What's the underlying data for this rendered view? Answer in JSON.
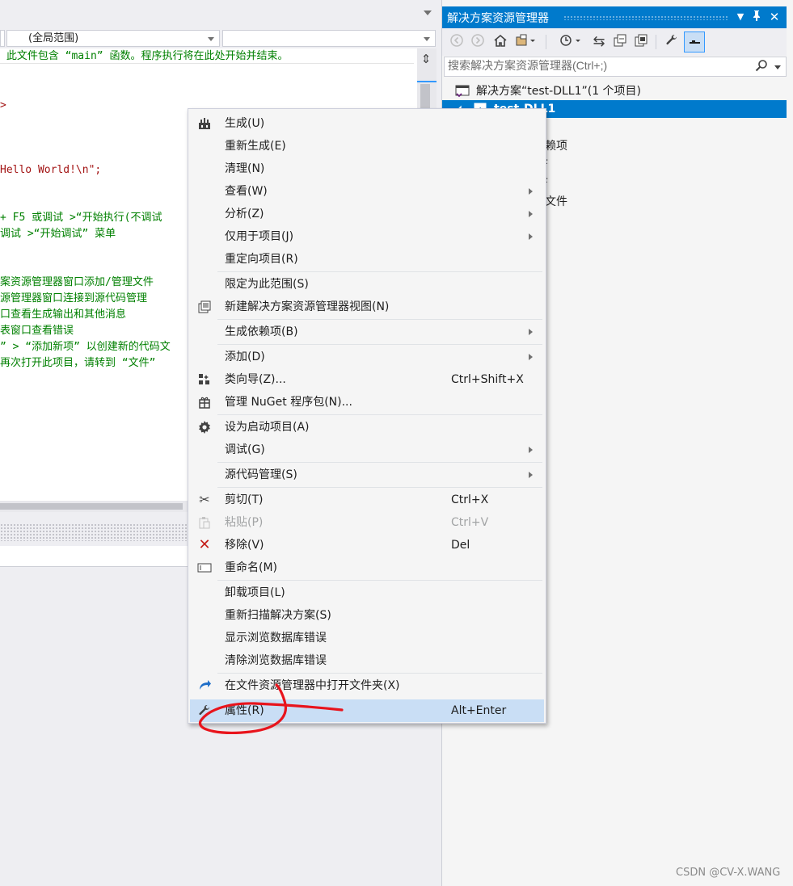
{
  "editor": {
    "scope_combo": "(全局范围)",
    "member_combo": "",
    "code_lines": [
      {
        "text": " 此文件包含 “main” 函数。程序执行将在此处开始并结束。",
        "kind": "comment"
      },
      {
        "text": ">",
        "kind": "string"
      },
      {
        "text": "Hello World!\\n\";",
        "kind": "string"
      },
      {
        "text": "+ F5 或调试 >“开始执行(不调试",
        "kind": "comment"
      },
      {
        "text": "调试 >“开始调试” 菜单",
        "kind": "comment"
      },
      {
        "text": "案资源管理器窗口添加/管理文件",
        "kind": "comment"
      },
      {
        "text": "源管理器窗口连接到源代码管理",
        "kind": "comment"
      },
      {
        "text": "口查看生成输出和其他消息",
        "kind": "comment"
      },
      {
        "text": "表窗口查看错误",
        "kind": "comment"
      },
      {
        "text": "” > “添加新项” 以创建新的代码文",
        "kind": "comment"
      },
      {
        "text": "再次打开此项目，请转到 “文件”",
        "kind": "comment"
      }
    ]
  },
  "solution_explorer": {
    "title": "解决方案资源管理器",
    "search_placeholder": "搜索解决方案资源管理器(Ctrl+;)",
    "solution_node": "解决方案“test-DLL1”(1 个项目)",
    "project_node": "test-DLL1",
    "partial_items": [
      "依赖项",
      "F",
      "F",
      "文件"
    ],
    "toolbar_icons": [
      "back-icon",
      "forward-icon",
      "home-icon",
      "switch-views-icon",
      "pending-changes-icon",
      "sync-icon",
      "collapse-all-icon",
      "show-all-files-icon",
      "properties-icon",
      "preview-icon"
    ]
  },
  "context_menu": {
    "items": [
      {
        "label": "生成(U)",
        "icon": "build-icon"
      },
      {
        "label": "重新生成(E)"
      },
      {
        "label": "清理(N)"
      },
      {
        "label": "查看(W)",
        "submenu": true
      },
      {
        "label": "分析(Z)",
        "submenu": true
      },
      {
        "label": "仅用于项目(J)",
        "submenu": true
      },
      {
        "label": "重定向项目(R)"
      },
      {
        "label": "限定为此范围(S)"
      },
      {
        "label": "新建解决方案资源管理器视图(N)",
        "icon": "new-view-icon"
      },
      {
        "label": "生成依赖项(B)",
        "submenu": true
      },
      {
        "label": "添加(D)",
        "submenu": true
      },
      {
        "label": "类向导(Z)...",
        "shortcut": "Ctrl+Shift+X",
        "icon": "class-wizard-icon"
      },
      {
        "label": "管理 NuGet 程序包(N)...",
        "icon": "nuget-icon"
      },
      {
        "label": "设为启动项目(A)",
        "icon": "gear-icon"
      },
      {
        "label": "调试(G)",
        "submenu": true
      },
      {
        "label": "源代码管理(S)",
        "submenu": true
      },
      {
        "label": "剪切(T)",
        "shortcut": "Ctrl+X",
        "icon": "cut-icon"
      },
      {
        "label": "粘贴(P)",
        "shortcut": "Ctrl+V",
        "icon": "paste-icon",
        "disabled": true
      },
      {
        "label": "移除(V)",
        "shortcut": "Del",
        "icon": "remove-icon"
      },
      {
        "label": "重命名(M)",
        "icon": "rename-icon"
      },
      {
        "label": "卸载项目(L)"
      },
      {
        "label": "重新扫描解决方案(S)"
      },
      {
        "label": "显示浏览数据库错误"
      },
      {
        "label": "清除浏览数据库错误"
      },
      {
        "label": "在文件资源管理器中打开文件夹(X)",
        "icon": "open-folder-icon"
      },
      {
        "label": "属性(R)",
        "shortcut": "Alt+Enter",
        "icon": "wrench-icon",
        "highlighted": true
      }
    ]
  },
  "colors": {
    "accent": "#007acc",
    "highlight": "#c9def5",
    "annotation": "#e8141c",
    "comment": "#008000",
    "string": "#a31515"
  },
  "watermark": "CSDN @CV-X.WANG"
}
